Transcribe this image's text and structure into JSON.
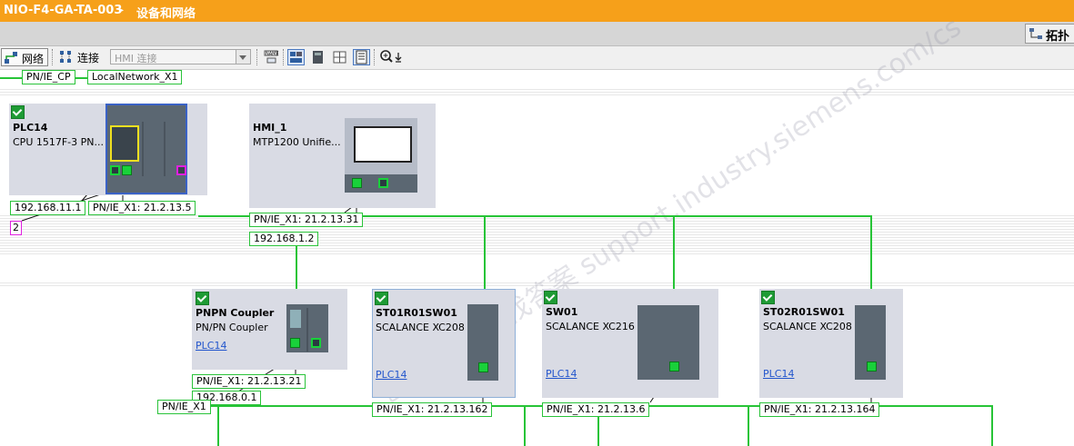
{
  "header": {
    "project": "NIO-F4-GA-TA-003",
    "separator": "▸",
    "section": "设备和网络"
  },
  "view_tab": {
    "label": "拓扑",
    "icon": "topology-view-icon"
  },
  "toolbar": {
    "network_label": "网络",
    "connections_label": "连接",
    "connection_type": "HMI 连接",
    "icons": [
      "network-view-icon",
      "connections-icon",
      "address-display-icon",
      "table-view-icon",
      "module-icon",
      "grid-icon",
      "page-break-icon",
      "zoom-icon"
    ]
  },
  "network_bar": {
    "interface": "PN/IE_CP",
    "subnet": "LocalNetwork_X1"
  },
  "watermark": {
    "text": "西门子工业 找答案 support.industry.siemens.com/cs"
  },
  "devices": {
    "plc14": {
      "name": "PLC14",
      "type": "CPU 1517F-3 PN...",
      "ip1": "192.168.11.1",
      "ip2": "PN/IE_X1: 21.2.13.5",
      "badge": "2"
    },
    "hmi1": {
      "name": "HMI_1",
      "type": "MTP1200 Unifie...",
      "ip1": "PN/IE_X1: 21.2.13.31",
      "ip2": "192.168.1.2"
    },
    "coupler": {
      "name": "PNPN Coupler",
      "type": "PN/PN Coupler",
      "link": "PLC14",
      "ip1": "PN/IE_X1: 21.2.13.21",
      "ip2": "192.168.0.1",
      "ip3": "PN/IE_X1"
    },
    "st01": {
      "name": "ST01R01SW01",
      "type": "SCALANCE XC208",
      "link": "PLC14",
      "ip": "PN/IE_X1: 21.2.13.162"
    },
    "sw01": {
      "name": "SW01",
      "type": "SCALANCE XC216",
      "link": "PLC14",
      "ip": "PN/IE_X1: 21.2.13.6"
    },
    "st02": {
      "name": "ST02R01SW01",
      "type": "SCALANCE XC208",
      "link": "PLC14",
      "ip": "PN/IE_X1: 21.2.13.164"
    }
  },
  "colors": {
    "title_bar": "#f6a01a",
    "network_line": "#27c437",
    "device_box": "#d9dbe4",
    "link": "#2255cc",
    "selection": "#3a62c6"
  }
}
